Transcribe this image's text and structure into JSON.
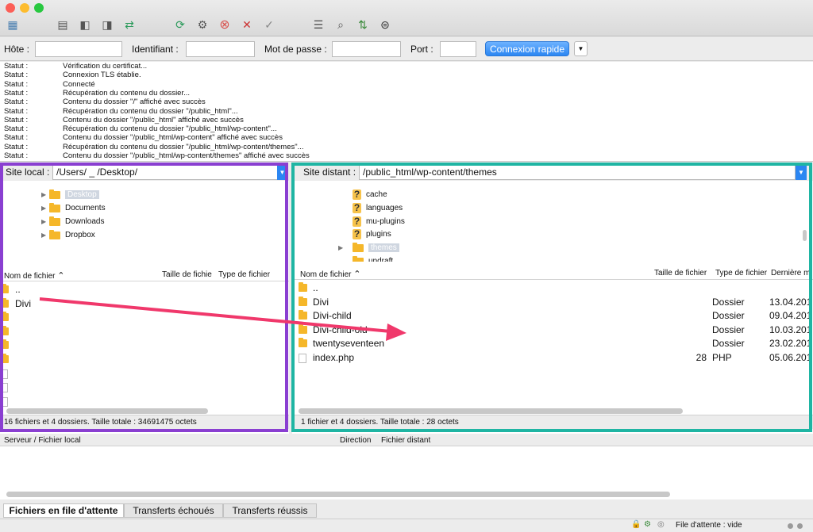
{
  "quickconnect": {
    "host_label": "Hôte :",
    "user_label": "Identifiant :",
    "pass_label": "Mot de passe :",
    "port_label": "Port :",
    "connect_label": "Connexion rapide"
  },
  "log": [
    {
      "k": "Statut :",
      "v": "Vérification du certificat..."
    },
    {
      "k": "Statut :",
      "v": "Connexion TLS établie."
    },
    {
      "k": "Statut :",
      "v": "Connecté"
    },
    {
      "k": "Statut :",
      "v": "Récupération du contenu du dossier..."
    },
    {
      "k": "Statut :",
      "v": "Contenu du dossier \"/\" affiché avec succès"
    },
    {
      "k": "Statut :",
      "v": "Récupération du contenu du dossier \"/public_html\"..."
    },
    {
      "k": "Statut :",
      "v": "Contenu du dossier \"/public_html\" affiché avec succès"
    },
    {
      "k": "Statut :",
      "v": "Récupération du contenu du dossier \"/public_html/wp-content\"..."
    },
    {
      "k": "Statut :",
      "v": "Contenu du dossier \"/public_html/wp-content\" affiché avec succès"
    },
    {
      "k": "Statut :",
      "v": "Récupération du contenu du dossier \"/public_html/wp-content/themes\"..."
    },
    {
      "k": "Statut :",
      "v": "Contenu du dossier \"/public_html/wp-content/themes\" affiché avec succès"
    }
  ],
  "local": {
    "site_label": "Site local :",
    "path": "/Users/ _            /Desktop/",
    "tree": [
      "Desktop",
      "Documents",
      "Downloads",
      "Dropbox"
    ],
    "col_name": "Nom de fichier",
    "col_size": "Taille de fichie",
    "col_type": "Type de fichier",
    "files": [
      "..",
      "Divi"
    ],
    "status": "16 fichiers et 4 dossiers. Taille totale : 34691475 octets"
  },
  "remote": {
    "site_label": "Site distant :",
    "path": "/public_html/wp-content/themes",
    "tree": [
      "cache",
      "languages",
      "mu-plugins",
      "plugins",
      "themes",
      "updraft"
    ],
    "col_name": "Nom de fichier",
    "col_size": "Taille de fichier",
    "col_type": "Type de fichier",
    "col_date": "Dernière m",
    "files": [
      {
        "name": "..",
        "size": "",
        "type": "",
        "date": ""
      },
      {
        "name": "Divi",
        "size": "",
        "type": "Dossier",
        "date": "13.04.201"
      },
      {
        "name": "Divi-child",
        "size": "",
        "type": "Dossier",
        "date": "09.04.201"
      },
      {
        "name": "Divi-child-old",
        "size": "",
        "type": "Dossier",
        "date": "10.03.201"
      },
      {
        "name": "twentyseventeen",
        "size": "",
        "type": "Dossier",
        "date": "23.02.201"
      },
      {
        "name": "index.php",
        "size": "28",
        "type": "PHP",
        "date": "05.06.201"
      }
    ],
    "status": "1 fichier et 4 dossiers. Taille totale : 28 octets"
  },
  "queue": {
    "col_server": "Serveur / Fichier local",
    "col_direction": "Direction",
    "col_remote": "Fichier distant"
  },
  "tabs": [
    "Fichiers en file d'attente",
    "Transferts échoués",
    "Transferts réussis"
  ],
  "bottom": {
    "queue_status": "File d'attente : vide"
  },
  "colors": {
    "local_highlight": "#8a3fd1",
    "remote_highlight": "#1fb5a3",
    "arrow": "#f0386b"
  }
}
